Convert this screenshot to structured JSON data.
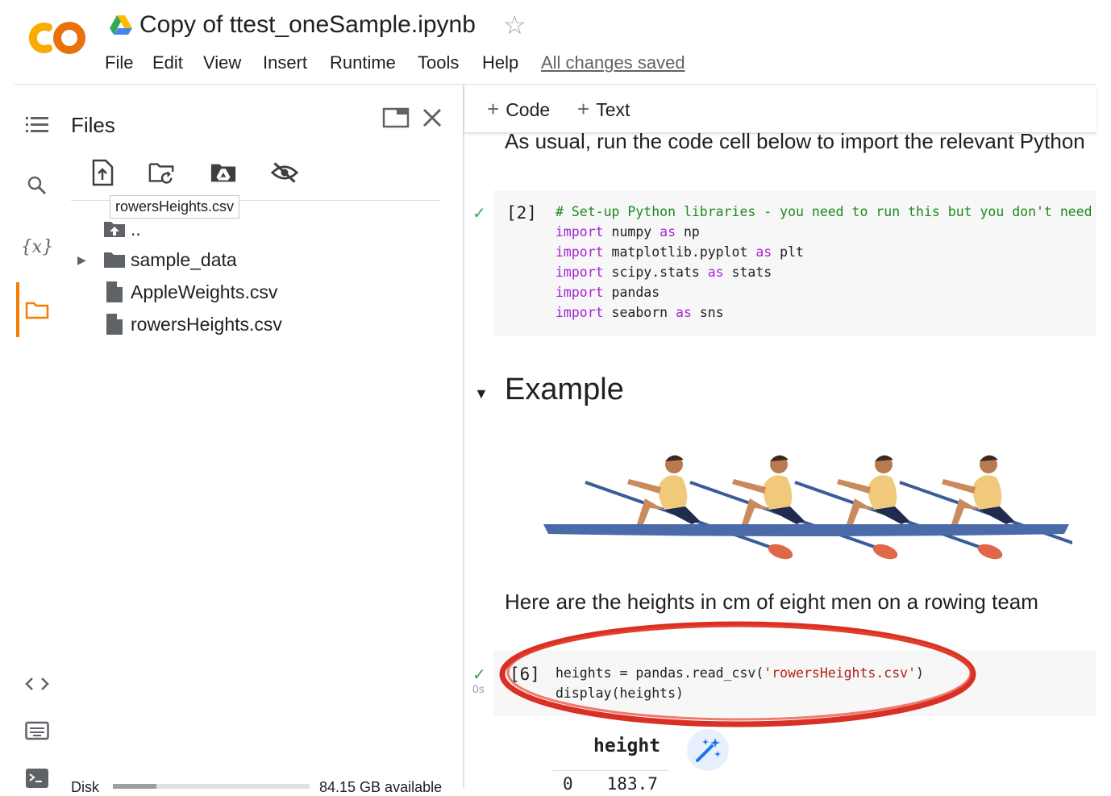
{
  "header": {
    "title": "Copy of ttest_oneSample.ipynb",
    "menu": [
      "File",
      "Edit",
      "View",
      "Insert",
      "Runtime",
      "Tools",
      "Help"
    ],
    "saved_status": "All changes saved"
  },
  "files_panel": {
    "title": "Files",
    "tooltip": "rowersHeights.csv",
    "items": [
      {
        "name": "..",
        "type": "parent"
      },
      {
        "name": "sample_data",
        "type": "folder"
      },
      {
        "name": "AppleWeights.csv",
        "type": "file"
      },
      {
        "name": "rowersHeights.csv",
        "type": "file"
      }
    ],
    "disk_label": "Disk",
    "disk_available": "84.15 GB available",
    "disk_used_fraction": 0.22
  },
  "toolbar": {
    "code_label": "Code",
    "text_label": "Text"
  },
  "notebook": {
    "intro_text": "As usual, run the code cell below to import the relevant Python",
    "cell1": {
      "exec_count": "[2]",
      "lines": [
        {
          "parts": [
            {
              "t": "# Set-up Python libraries - you need to run this but you don't need",
              "c": "cm"
            }
          ]
        },
        {
          "parts": [
            {
              "t": "import",
              "c": "kw"
            },
            {
              "t": " numpy ",
              "c": ""
            },
            {
              "t": "as",
              "c": "kw"
            },
            {
              "t": " np",
              "c": ""
            }
          ]
        },
        {
          "parts": [
            {
              "t": "import",
              "c": "kw"
            },
            {
              "t": " matplotlib.pyplot ",
              "c": ""
            },
            {
              "t": "as",
              "c": "kw"
            },
            {
              "t": " plt",
              "c": ""
            }
          ]
        },
        {
          "parts": [
            {
              "t": "import",
              "c": "kw"
            },
            {
              "t": " scipy.stats ",
              "c": ""
            },
            {
              "t": "as",
              "c": "kw"
            },
            {
              "t": " stats",
              "c": ""
            }
          ]
        },
        {
          "parts": [
            {
              "t": "import",
              "c": "kw"
            },
            {
              "t": " pandas",
              "c": ""
            }
          ]
        },
        {
          "parts": [
            {
              "t": "import",
              "c": "kw"
            },
            {
              "t": " seaborn ",
              "c": ""
            },
            {
              "t": "as",
              "c": "kw"
            },
            {
              "t": " sns",
              "c": ""
            }
          ]
        }
      ]
    },
    "example_heading": "Example",
    "heights_text": "Here are the heights in cm of eight men on a rowing team",
    "cell2": {
      "exec_count": "[6]",
      "run_time": "0s",
      "lines": [
        {
          "parts": [
            {
              "t": "heights = pandas.read_csv(",
              "c": ""
            },
            {
              "t": "'rowersHeights.csv'",
              "c": "str"
            },
            {
              "t": ")",
              "c": ""
            }
          ]
        },
        {
          "parts": [
            {
              "t": "display(heights)",
              "c": ""
            }
          ]
        }
      ]
    },
    "output": {
      "column_header": "height",
      "first_row_index": "0",
      "first_row_value": "183.7"
    }
  },
  "colors": {
    "accent": "#f57c00",
    "annotation": "#d93025"
  }
}
